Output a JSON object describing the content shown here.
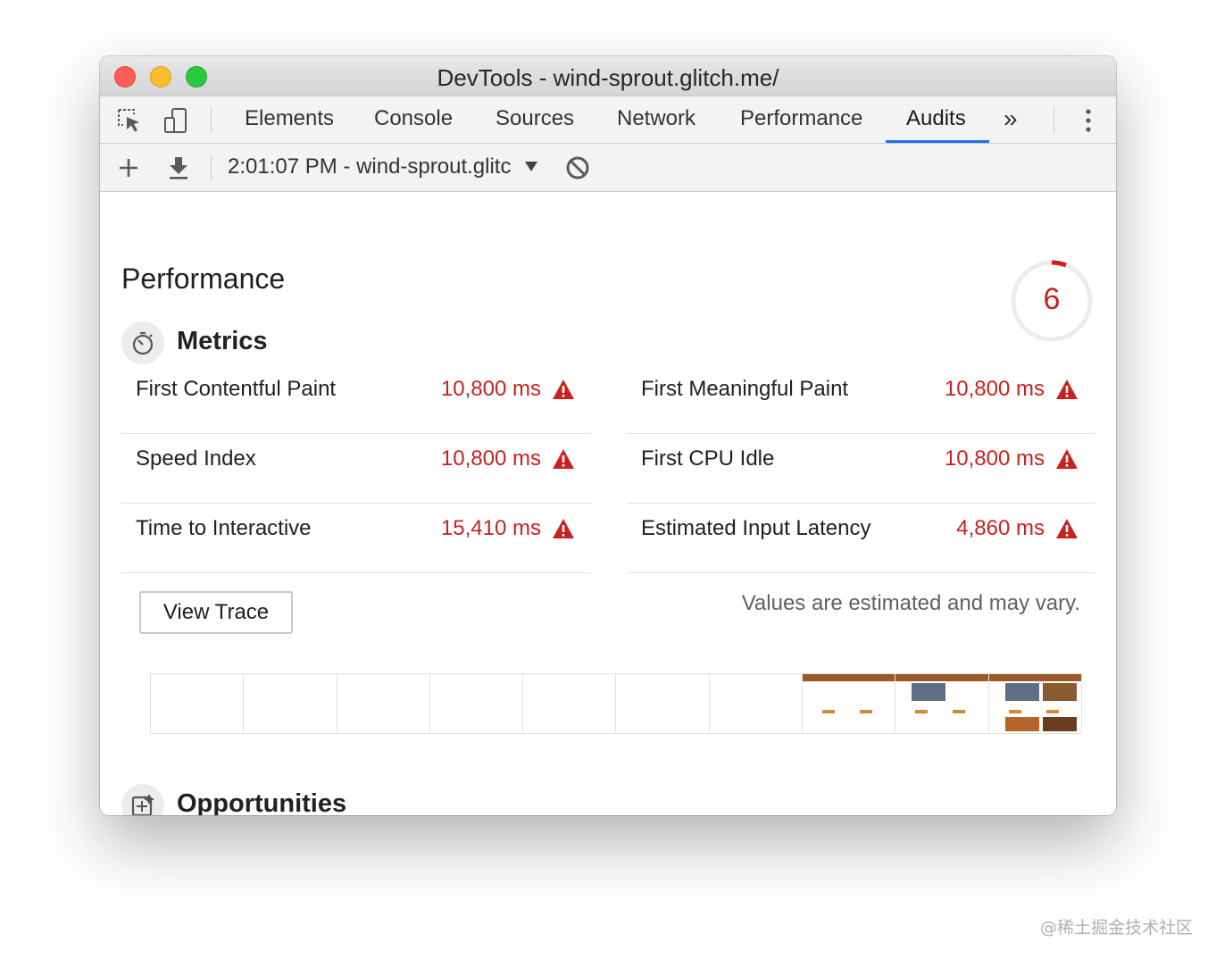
{
  "window": {
    "title": "DevTools - wind-sprout.glitch.me/"
  },
  "toolbar": {
    "tabs": [
      {
        "label": "Elements"
      },
      {
        "label": "Console"
      },
      {
        "label": "Sources"
      },
      {
        "label": "Network"
      },
      {
        "label": "Performance"
      },
      {
        "label": "Audits"
      }
    ],
    "active_tab": "Audits",
    "overflow_label": "»",
    "icons": [
      "inspect-element-icon",
      "device-toolbar-icon",
      "more-overflow-icon",
      "kebab-menu-icon"
    ]
  },
  "subbar": {
    "report": "2:01:07 PM - wind-sprout.glitc",
    "icons": [
      "plus-icon",
      "download-icon",
      "dropdown-arrow-icon",
      "block-icon"
    ]
  },
  "performance": {
    "title": "Performance",
    "score": "6",
    "score_fraction": 0.06,
    "score_color": "#c7221f",
    "metrics": {
      "title": "Metrics",
      "icon": "stopwatch-icon",
      "items": [
        {
          "label": "First Contentful Paint",
          "value": "10,800 ms"
        },
        {
          "label": "First Meaningful Paint",
          "value": "10,800 ms"
        },
        {
          "label": "Speed Index",
          "value": "10,800 ms"
        },
        {
          "label": "First CPU Idle",
          "value": "10,800 ms"
        },
        {
          "label": "Time to Interactive",
          "value": "15,410 ms"
        },
        {
          "label": "Estimated Input Latency",
          "value": "4,860 ms"
        }
      ],
      "status_icon": "warning-triangle-icon",
      "status_color": "#c7221f"
    },
    "view_trace_label": "View Trace",
    "note": "Values are estimated and may vary.",
    "filmstrip_frames": 10,
    "filmstrip_rendered_from": 8
  },
  "opportunities": {
    "title": "Opportunities",
    "icon": "opportunities-icon"
  },
  "watermark": "@稀土掘金技术社区"
}
